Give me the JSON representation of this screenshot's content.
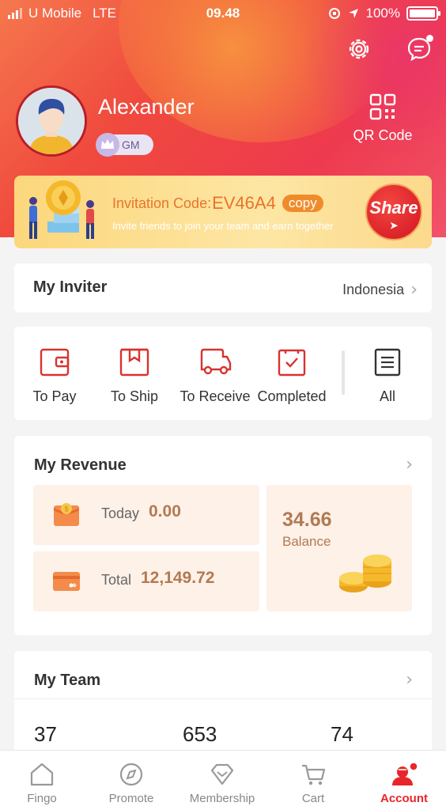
{
  "status_bar": {
    "carrier": "U Mobile",
    "network": "LTE",
    "time": "09.48",
    "battery": "100%"
  },
  "header": {
    "username": "Alexander",
    "level_badge": "GM",
    "qr_label": "QR Code"
  },
  "invite": {
    "code_label": "Invitation Code:",
    "code": "EV46A4",
    "copy_label": "copy",
    "subtitle": "Invite friends to join your team and earn together",
    "share_label": "Share"
  },
  "inviter": {
    "label": "My Inviter",
    "value": "Indonesia"
  },
  "orders": {
    "items": [
      {
        "label": "To Pay",
        "icon": "wallet-icon"
      },
      {
        "label": "To Ship",
        "icon": "package-icon"
      },
      {
        "label": "To Receive",
        "icon": "truck-icon"
      },
      {
        "label": "Completed",
        "icon": "check-box-icon"
      },
      {
        "label": "All",
        "icon": "list-icon"
      }
    ]
  },
  "revenue": {
    "title": "My Revenue",
    "today_label": "Today",
    "today_value": "0.00",
    "total_label": "Total",
    "total_value": "12,149.72",
    "balance_value": "34.66",
    "balance_label": "Balance"
  },
  "team": {
    "title": "My Team",
    "stats": [
      "37",
      "653",
      "74"
    ]
  },
  "tabbar": {
    "items": [
      {
        "label": "Fingo",
        "icon": "home-icon"
      },
      {
        "label": "Promote",
        "icon": "compass-icon"
      },
      {
        "label": "Membership",
        "icon": "diamond-icon"
      },
      {
        "label": "Cart",
        "icon": "cart-icon"
      },
      {
        "label": "Account",
        "icon": "person-icon",
        "active": true
      }
    ]
  },
  "colors": {
    "accent": "#e8262a",
    "revenue_text": "#b27a52",
    "invite_text": "#e8742a"
  }
}
